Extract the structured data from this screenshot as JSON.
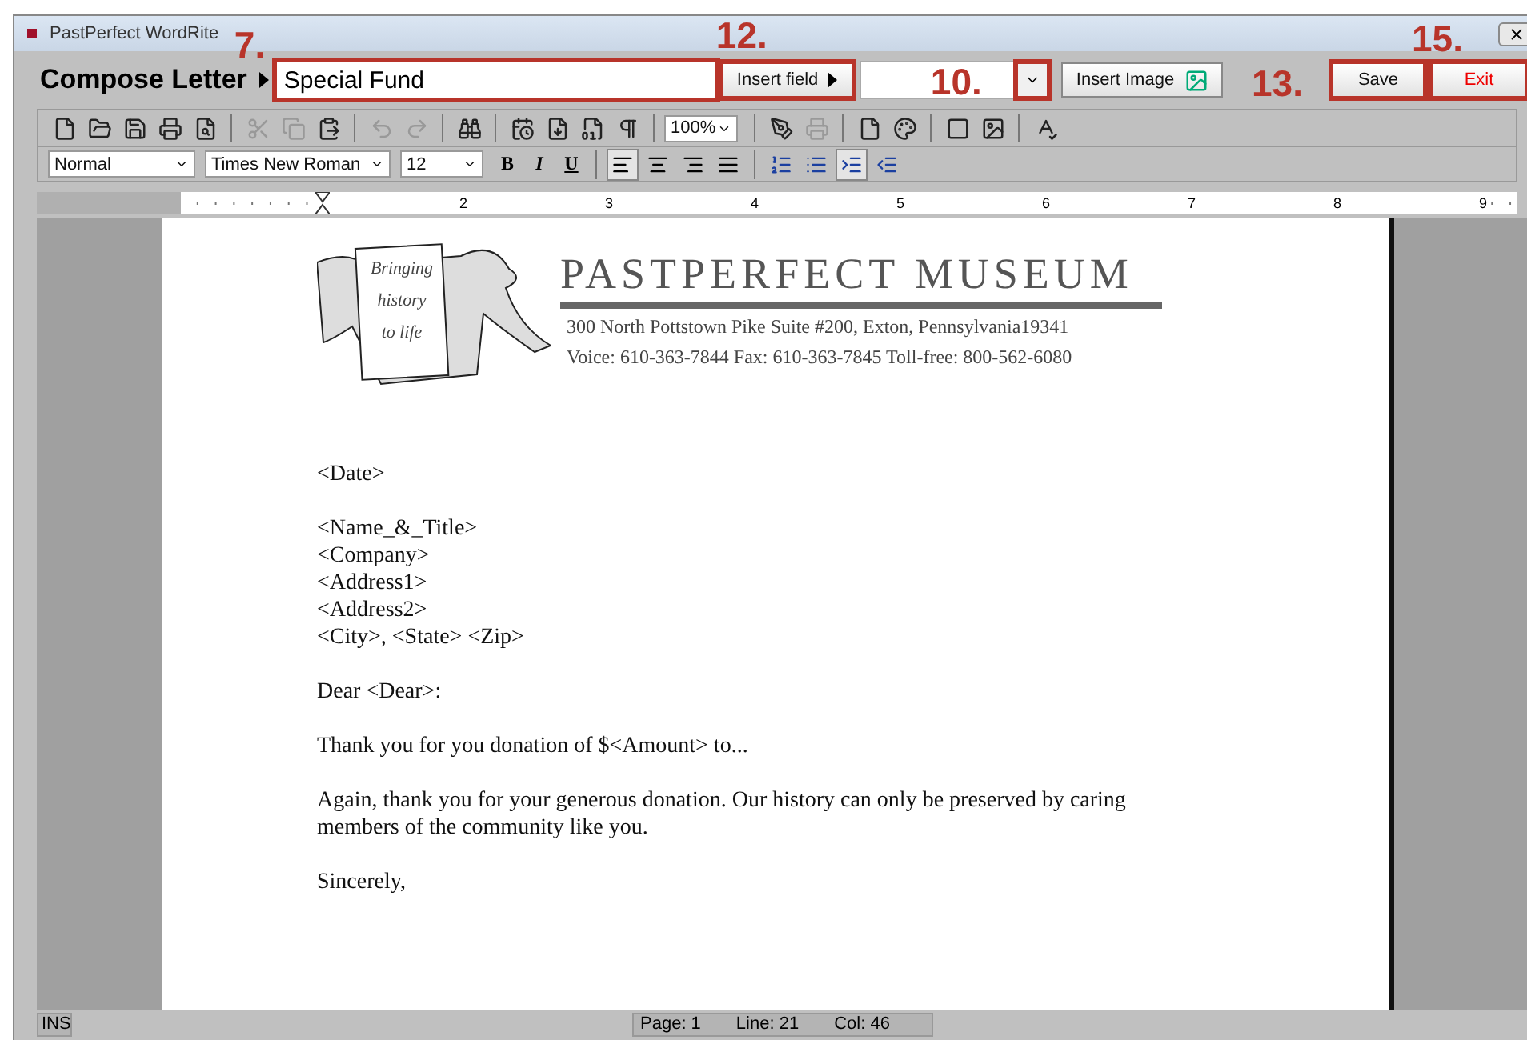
{
  "window": {
    "title": "PastPerfect WordRite"
  },
  "header": {
    "title": "Compose Letter",
    "name_field": {
      "value": "Special Fund",
      "highlighted": true,
      "callout": "7."
    },
    "insert_field_button": {
      "label": "Insert field",
      "highlighted": true,
      "callout": "12."
    },
    "field_combo": {
      "highlighted": true,
      "callout": "10."
    },
    "insert_image_button": {
      "label": "Insert Image"
    },
    "save_button": {
      "label": "Save",
      "highlighted": true,
      "callout": "13."
    },
    "exit_button": {
      "label": "Exit",
      "highlighted": true,
      "callout": "15."
    }
  },
  "toolbar": {
    "groups": [
      [
        {
          "disabled": false
        },
        {
          "disabled": false
        },
        {
          "disabled": false
        },
        {
          "disabled": false
        },
        {
          "disabled": false
        }
      ],
      [
        {
          "disabled": true
        },
        {
          "disabled": true
        },
        {
          "disabled": false
        }
      ],
      [
        {
          "disabled": true
        },
        {
          "disabled": true
        }
      ],
      [
        {
          "disabled": false
        }
      ],
      [
        {
          "disabled": false
        },
        {
          "disabled": false
        },
        {
          "disabled": false
        },
        {
          "disabled": false
        }
      ]
    ],
    "zoom": "100%",
    "groups_after": [
      [
        {
          "disabled": false
        },
        {
          "disabled": true
        }
      ],
      [
        {
          "disabled": false
        },
        {
          "disabled": false
        }
      ],
      [
        {
          "disabled": false
        },
        {
          "disabled": false
        }
      ],
      [
        {
          "disabled": false
        }
      ]
    ]
  },
  "format_bar": {
    "style": "Normal",
    "font": "Times New Roman",
    "size": "12",
    "text_buttons": [
      {
        "label": "B",
        "selected": false
      },
      {
        "label": "I",
        "selected": false
      },
      {
        "label": "U",
        "selected": false
      }
    ],
    "align_buttons": [
      {
        "selected": true
      },
      {
        "selected": false
      },
      {
        "selected": false
      },
      {
        "selected": false
      }
    ],
    "list_buttons": [
      {
        "selected": false
      },
      {
        "selected": false
      },
      {
        "selected": true
      },
      {
        "selected": false
      }
    ]
  },
  "ruler": {
    "numbers": [
      "2",
      "3",
      "4",
      "5",
      "6",
      "7",
      "8",
      "9"
    ]
  },
  "letterhead": {
    "banner": [
      "Bringing",
      "history",
      "to life"
    ],
    "name": "PASTPERFECT MUSEUM",
    "address": "300 North Pottstown Pike  Suite #200, Exton, Pennsylvania19341",
    "phones": "Voice: 610-363-7844  Fax: 610-363-7845  Toll-free: 800-562-6080"
  },
  "letter": [
    [
      "<Date>"
    ],
    [
      "<Name_&_Title>",
      "<Company>",
      "<Address1>",
      "<Address2>",
      "<City>, <State> <Zip>"
    ],
    [
      "Dear <Dear>:"
    ],
    [
      "Thank you for you donation of $<Amount> to..."
    ],
    [
      "Again, thank you for your generous donation.  Our history can only be preserved by caring members of the community like you."
    ],
    [
      "Sincerely,"
    ]
  ],
  "status_bar": {
    "mode": "INS",
    "page": "Page: 1",
    "line": "Line: 21",
    "col": "Col: 46"
  }
}
